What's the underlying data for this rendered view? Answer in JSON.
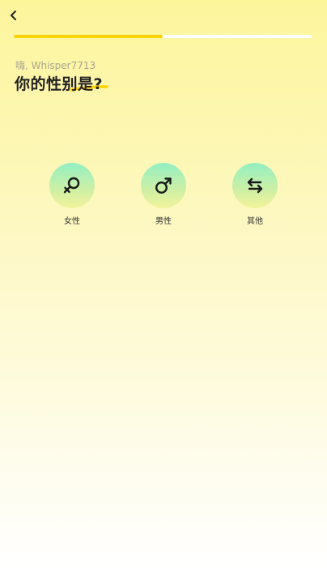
{
  "header": {
    "back_icon": "chevron-left-icon",
    "progress_fraction": 0.5
  },
  "greeting": "嗨, Whisper7713",
  "question": "你的性别是?",
  "colors": {
    "accent": "#ffd400",
    "background_top": "#fdf59c",
    "option_gradient_top": "#93efc3",
    "option_gradient_bottom": "#f3f29a"
  },
  "options": [
    {
      "label": "女性",
      "icon": "female-symbol-icon"
    },
    {
      "label": "男性",
      "icon": "male-symbol-icon"
    },
    {
      "label": "其他",
      "icon": "swap-arrows-icon"
    }
  ]
}
